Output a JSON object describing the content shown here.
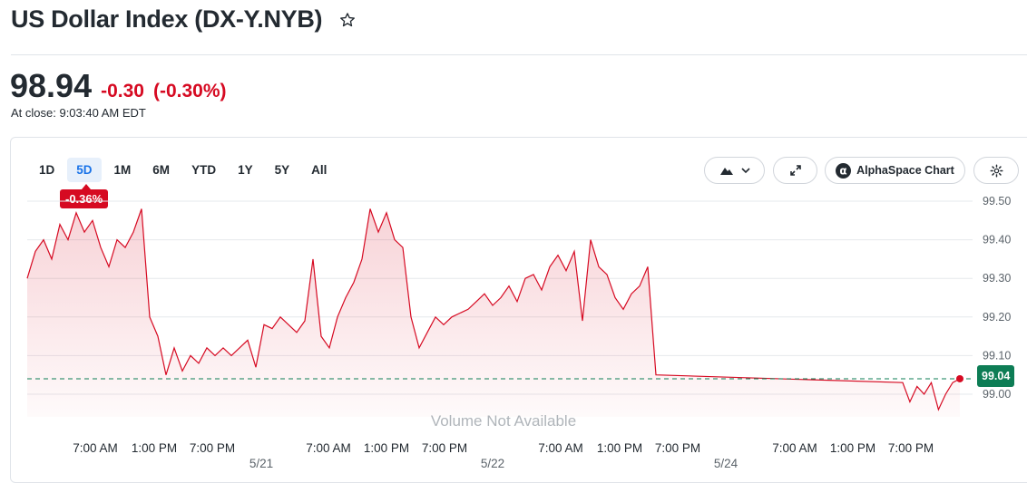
{
  "header": {
    "title": "US Dollar Index (DX-Y.NYB)",
    "price": "98.94",
    "change": "-0.30",
    "change_pct": "(-0.30%)",
    "close_time": "At close: 9:03:40 AM EDT"
  },
  "chart_toolbar": {
    "ranges": [
      "1D",
      "5D",
      "1M",
      "6M",
      "YTD",
      "1Y",
      "5Y",
      "All"
    ],
    "active_range": "5D",
    "alphaspace_label": "AlphaSpace Chart",
    "period_change": "-0.36%",
    "last_price_label": "99.04",
    "volume_text": "Volume Not Available"
  },
  "colors": {
    "accent": "#1a73e8",
    "negative": "#d60a22",
    "positive": "#0d7d55",
    "line": "#d60a22"
  },
  "chart_data": {
    "type": "area",
    "ylim": [
      98.92,
      99.56
    ],
    "y_ticks": [
      99.0,
      99.1,
      99.2,
      99.3,
      99.4,
      99.5
    ],
    "y_tick_labels": [
      "99.00",
      "99.10",
      "99.20",
      "99.30",
      "99.40",
      "99.50"
    ],
    "x_tick_labels": [
      "7:00 AM",
      "1:00 PM",
      "7:00 PM",
      "7:00 AM",
      "1:00 PM",
      "7:00 PM",
      "7:00 AM",
      "1:00 PM",
      "7:00 PM",
      "7:00 AM",
      "1:00 PM",
      "7:00 PM"
    ],
    "date_labels": [
      "5/21",
      "5/22",
      "5/24"
    ],
    "reference_line": 99.04,
    "last_value": 99.04,
    "series": [
      {
        "values": [
          99.3,
          99.37,
          99.4,
          99.35,
          99.44,
          99.4,
          99.47,
          99.42,
          99.45,
          99.38,
          99.33,
          99.4,
          99.38,
          99.42,
          99.48,
          99.2,
          99.15,
          99.05,
          99.12,
          99.06,
          99.1,
          99.08,
          99.12,
          99.1,
          99.12,
          99.1,
          99.12,
          99.14,
          99.07,
          99.18,
          99.17,
          99.2,
          99.18,
          99.16,
          99.19,
          99.35,
          99.15,
          99.12,
          99.2,
          99.25,
          99.29,
          99.35,
          99.48,
          99.42,
          99.47,
          99.4,
          99.38,
          99.2,
          99.12,
          99.16,
          99.2,
          99.18,
          99.2,
          99.21,
          99.22,
          99.24,
          99.26,
          99.23,
          99.25,
          99.28,
          99.24,
          99.3,
          99.31,
          99.27,
          99.33,
          99.36,
          99.32,
          99.37,
          99.19,
          99.4,
          99.33,
          99.31,
          99.25,
          99.22,
          99.26,
          99.28,
          99.33,
          99.05,
          99.03,
          98.98,
          99.02,
          99.0,
          99.03,
          98.96,
          99.0,
          99.03,
          99.04
        ]
      }
    ]
  }
}
